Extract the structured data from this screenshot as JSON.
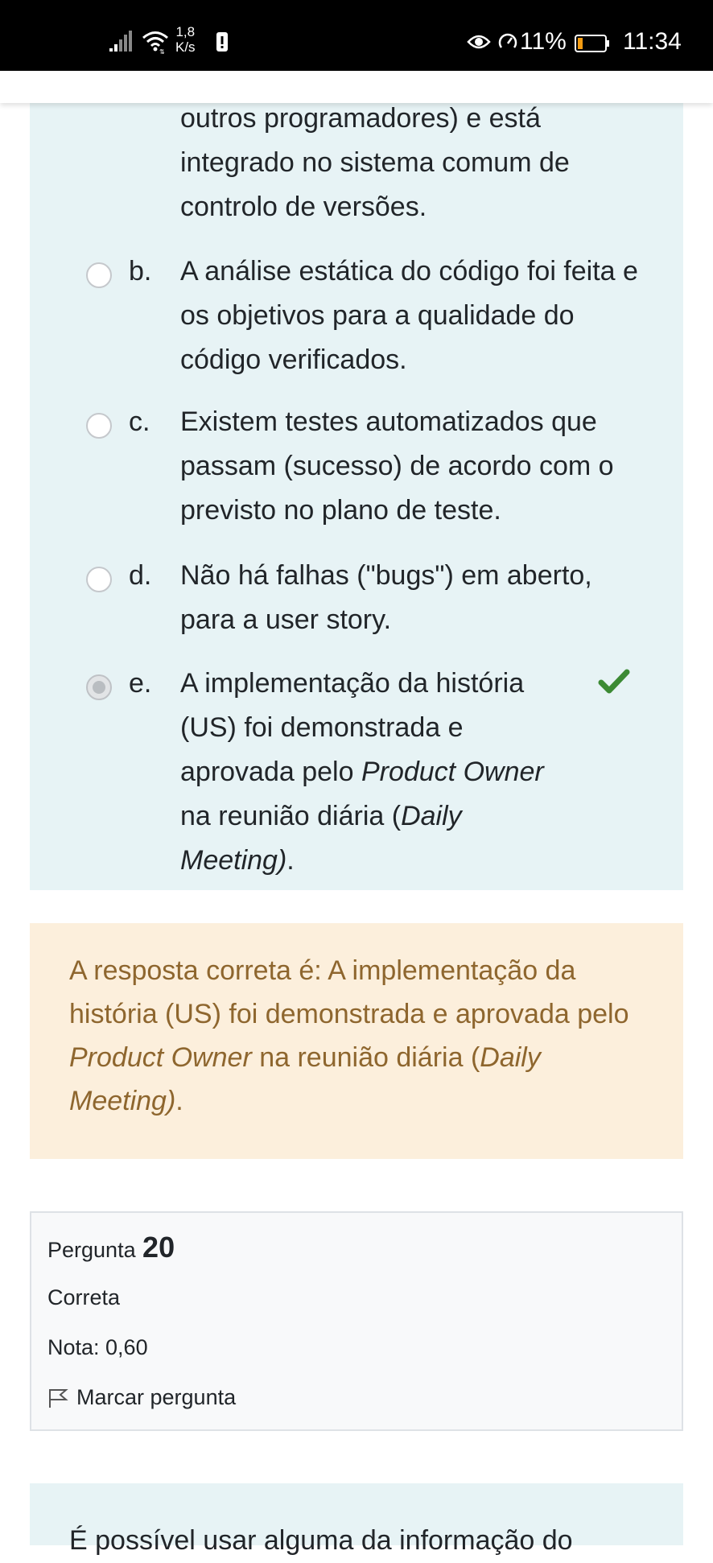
{
  "status_bar": {
    "network_speed_value": "1,8",
    "network_speed_unit": "K/s",
    "battery_percent": "11%",
    "time": "11:34"
  },
  "question": {
    "previous_option_tail": "outros programadores) e está integrado no sistema comum de controlo de versões.",
    "options": [
      {
        "letter": "b.",
        "text": "A análise estática do código foi feita e os objetivos para a qualidade do código verificados.",
        "selected": false
      },
      {
        "letter": "c.",
        "text": "Existem testes automatizados que passam (sucesso) de acordo com o previsto no plano de teste.",
        "selected": false
      },
      {
        "letter": "d.",
        "text": "Não há falhas (\"bugs\") em aberto, para a user story.",
        "selected": false
      },
      {
        "letter": "e.",
        "text_part1": "A implementação da história (US) foi demonstrada e aprovada pelo ",
        "text_em1": "Product Owner",
        "text_part2": " na reunião diária (",
        "text_em2": "Daily Meeting)",
        "text_part3": ".",
        "selected": true,
        "correct_mark": "check-icon"
      }
    ]
  },
  "feedback": {
    "part1": "A resposta correta é: A implementação da história (US) foi demonstrada e aprovada pelo ",
    "em1": "Product Owner",
    "part2": " na reunião diária (",
    "em2": "Daily Meeting)",
    "part3": "."
  },
  "question_info": {
    "label": "Pergunta",
    "number": "20",
    "state": "Correta",
    "grade": "Nota: 0,60",
    "flag_label": "Marcar pergunta"
  },
  "next_question": {
    "text_start": "É possível usar alguma da informação do"
  },
  "colors": {
    "question_bg": "#e7f3f5",
    "feedback_bg": "#fcefdc",
    "feedback_text": "#8e662e",
    "correct_check": "#3c8a34"
  }
}
